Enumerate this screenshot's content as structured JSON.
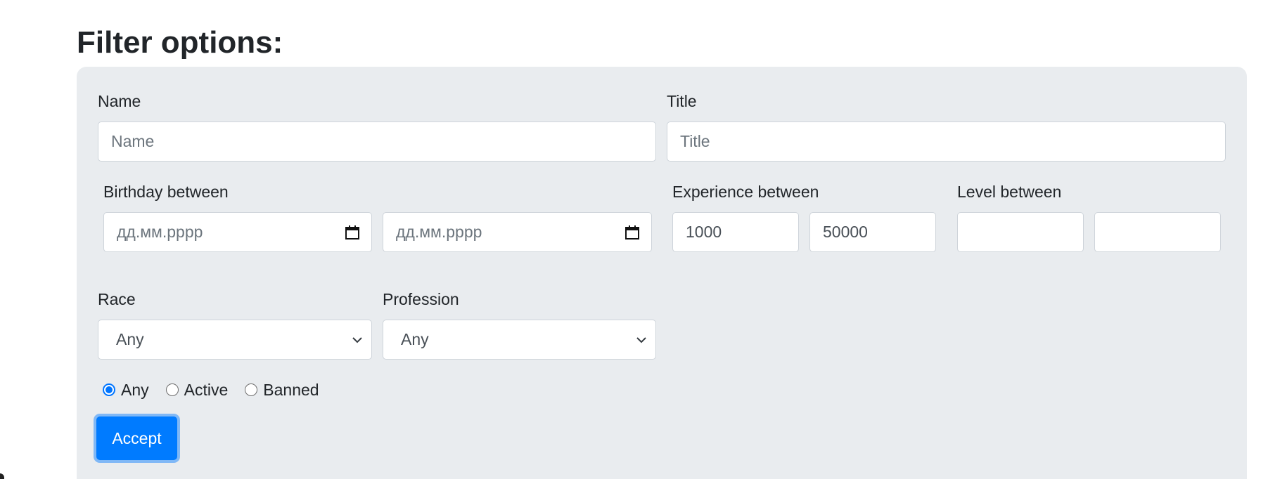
{
  "page": {
    "title": "Filter options:"
  },
  "filters": {
    "name": {
      "label": "Name",
      "placeholder": "Name",
      "value": ""
    },
    "title": {
      "label": "Title",
      "placeholder": "Title",
      "value": ""
    },
    "birthday": {
      "label": "Birthday between",
      "from_placeholder": "дд.мм.рррр",
      "to_placeholder": "дд.мм.рррр"
    },
    "experience": {
      "label": "Experience between",
      "min": "1000",
      "max": "50000"
    },
    "level": {
      "label": "Level between",
      "min": "",
      "max": ""
    },
    "race": {
      "label": "Race",
      "selected": "Any"
    },
    "profession": {
      "label": "Profession",
      "selected": "Any"
    },
    "status": {
      "options": [
        {
          "label": "Any",
          "checked": true
        },
        {
          "label": "Active",
          "checked": false
        },
        {
          "label": "Banned",
          "checked": false
        }
      ]
    },
    "accept_label": "Accept"
  },
  "icons": {
    "date_picker": "calendar-icon",
    "select_arrow": "chevron-down-icon"
  },
  "colors": {
    "panel_bg": "#e9ecef",
    "accent": "#007bff",
    "radio_accent": "#0075ff"
  }
}
